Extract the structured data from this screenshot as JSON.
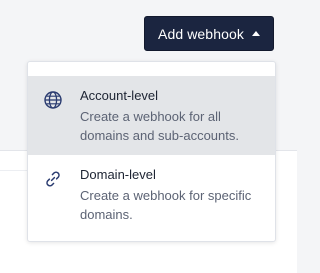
{
  "toolbar": {
    "add_webhook_label": "Add webhook",
    "caret_icon": "caret-up-icon"
  },
  "dropdown": {
    "items": [
      {
        "title": "Account-level",
        "description": "Create a webhook for all domains and sub-accounts.",
        "icon": "globe-icon",
        "active": true
      },
      {
        "title": "Domain-level",
        "description": "Create a webhook for specific domains.",
        "icon": "link-icon",
        "active": false
      }
    ]
  },
  "colors": {
    "button_bg": "#1b2540",
    "active_item_bg": "#e3e5e8",
    "icon_color": "#2a3b70"
  }
}
